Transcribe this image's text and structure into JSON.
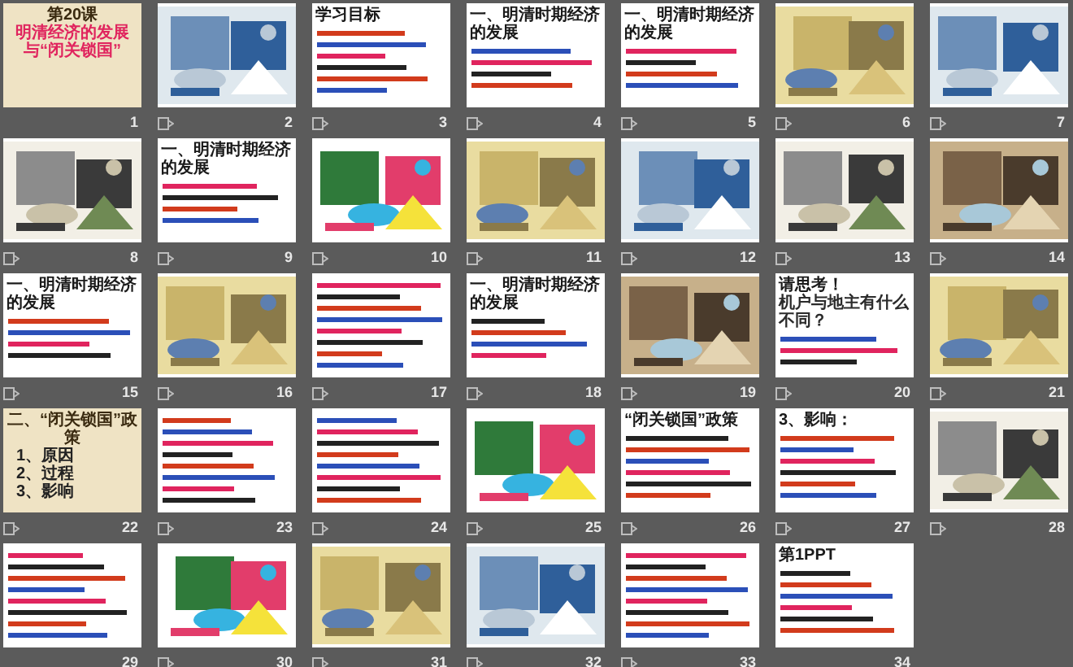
{
  "slides": [
    {
      "number": "1",
      "kind": "parchment",
      "transition": false,
      "texts": [
        "第20课",
        "明清经济的发展与“闭关锁国”"
      ]
    },
    {
      "number": "2",
      "kind": "picture",
      "transition": true
    },
    {
      "number": "3",
      "kind": "text",
      "transition": true,
      "texts": [
        "学习目标"
      ]
    },
    {
      "number": "4",
      "kind": "text",
      "transition": true,
      "texts": [
        "一、明清时期经济的发展"
      ]
    },
    {
      "number": "5",
      "kind": "text",
      "transition": true,
      "texts": [
        "一、明清时期经济的发展"
      ]
    },
    {
      "number": "6",
      "kind": "picture",
      "transition": true
    },
    {
      "number": "7",
      "kind": "picture",
      "transition": true
    },
    {
      "number": "8",
      "kind": "picture",
      "transition": true
    },
    {
      "number": "9",
      "kind": "text",
      "transition": true,
      "texts": [
        "一、明清时期经济的发展"
      ]
    },
    {
      "number": "10",
      "kind": "picture",
      "transition": true
    },
    {
      "number": "11",
      "kind": "picture",
      "transition": true
    },
    {
      "number": "12",
      "kind": "picture",
      "transition": true
    },
    {
      "number": "13",
      "kind": "picture",
      "transition": true
    },
    {
      "number": "14",
      "kind": "picture",
      "transition": true
    },
    {
      "number": "15",
      "kind": "text",
      "transition": true,
      "texts": [
        "一、明清时期经济的发展"
      ]
    },
    {
      "number": "16",
      "kind": "picture",
      "transition": true
    },
    {
      "number": "17",
      "kind": "text",
      "transition": true
    },
    {
      "number": "18",
      "kind": "text",
      "transition": true,
      "texts": [
        "一、明清时期经济的发展"
      ]
    },
    {
      "number": "19",
      "kind": "picture",
      "transition": true
    },
    {
      "number": "20",
      "kind": "text",
      "transition": true,
      "texts": [
        "请思考！",
        "机户与地主有什么不同？"
      ]
    },
    {
      "number": "21",
      "kind": "picture",
      "transition": true
    },
    {
      "number": "22",
      "kind": "parchment",
      "transition": true,
      "texts": [
        "二、“闭关锁国”政策",
        "1、原因",
        "2、过程",
        "3、影响"
      ]
    },
    {
      "number": "23",
      "kind": "text",
      "transition": true
    },
    {
      "number": "24",
      "kind": "text",
      "transition": true
    },
    {
      "number": "25",
      "kind": "picture",
      "transition": true
    },
    {
      "number": "26",
      "kind": "text",
      "transition": true,
      "texts": [
        "“闭关锁国”政策"
      ]
    },
    {
      "number": "27",
      "kind": "text",
      "transition": true,
      "texts": [
        "3、影响："
      ]
    },
    {
      "number": "28",
      "kind": "picture",
      "transition": true
    },
    {
      "number": "29",
      "kind": "text",
      "transition": false
    },
    {
      "number": "30",
      "kind": "picture",
      "transition": true
    },
    {
      "number": "31",
      "kind": "picture",
      "transition": true
    },
    {
      "number": "32",
      "kind": "picture",
      "transition": true
    },
    {
      "number": "33",
      "kind": "text",
      "transition": true
    },
    {
      "number": "34",
      "kind": "text",
      "transition": false,
      "texts": [
        "第1PPT"
      ]
    }
  ]
}
